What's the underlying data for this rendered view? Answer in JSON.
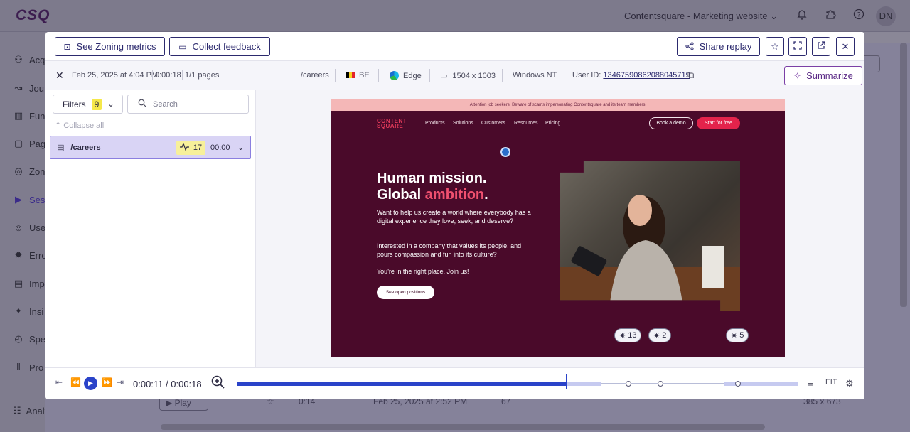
{
  "app": {
    "logo": "CSQ",
    "workspace": "Contentsquare - Marketing website",
    "avatar": "DN"
  },
  "sidebar": {
    "items": [
      {
        "label": "Acq",
        "icon": "user-plus-icon"
      },
      {
        "label": "Jou",
        "icon": "journey-icon"
      },
      {
        "label": "Fun",
        "icon": "funnel-icon"
      },
      {
        "label": "Pag",
        "icon": "page-icon"
      },
      {
        "label": "Zon",
        "icon": "zoning-icon"
      },
      {
        "label": "Ses",
        "icon": "session-icon"
      },
      {
        "label": "Use",
        "icon": "users-icon"
      },
      {
        "label": "Erro",
        "icon": "error-icon"
      },
      {
        "label": "Imp",
        "icon": "impact-icon"
      },
      {
        "label": "Insi",
        "icon": "insight-icon"
      },
      {
        "label": "Spe",
        "icon": "speed-icon"
      },
      {
        "label": "Pro",
        "icon": "product-icon"
      }
    ],
    "setup_label": "Analysis setup"
  },
  "background_table": {
    "play_label": "Play",
    "duration": "0:14",
    "date": "Feb 25, 2025 at 2:52 PM",
    "count": "67",
    "resolution": "385 x 673"
  },
  "modal": {
    "toolbar": {
      "zoning_label": "See Zoning metrics",
      "feedback_label": "Collect feedback",
      "share_label": "Share replay"
    },
    "info": {
      "datetime": "Feb 25, 2025 at 4:04 PM",
      "duration": "0:00:18",
      "pages": "1/1 pages",
      "path": "/careers",
      "country": "BE",
      "browser": "Edge",
      "resolution": "1504 x 1003",
      "os": "Windows NT",
      "user_id_label": "User ID:",
      "user_id": "13467590862088045719",
      "summarize_label": "Summarize"
    },
    "panel": {
      "filters_label": "Filters",
      "filters_count": "9",
      "search_placeholder": "Search",
      "collapse_label": "Collapse all",
      "page_path": "/careers",
      "page_events": "17",
      "page_time": "00:00"
    },
    "site": {
      "banner": "Attention job seekers! Beware of scams impersonating Contentsquare and its team members.",
      "logo_line1": "CONTENT",
      "logo_line2": "SQUARE",
      "nav": [
        "Products",
        "Solutions",
        "Customers",
        "Resources",
        "Pricing"
      ],
      "demo_label": "Book a demo",
      "free_label": "Start for free",
      "heading_line1": "Human mission.",
      "heading_line2_a": "Global",
      "heading_line2_b": "ambition",
      "heading_dot": ".",
      "para1": "Want to help us create a world where everybody has a digital experience they love, seek, and deserve?",
      "para2": "Interested in a company that values its people, and pours compassion and fun into its culture?",
      "para3": "You're in the right place. Join us!",
      "cta_label": "See open positions"
    },
    "player": {
      "time": "0:00:11 / 0:00:18",
      "progress": 0.611,
      "events": [
        {
          "count": "13"
        },
        {
          "count": "2"
        },
        {
          "count": "5"
        }
      ],
      "fit_label": "FIT"
    }
  }
}
